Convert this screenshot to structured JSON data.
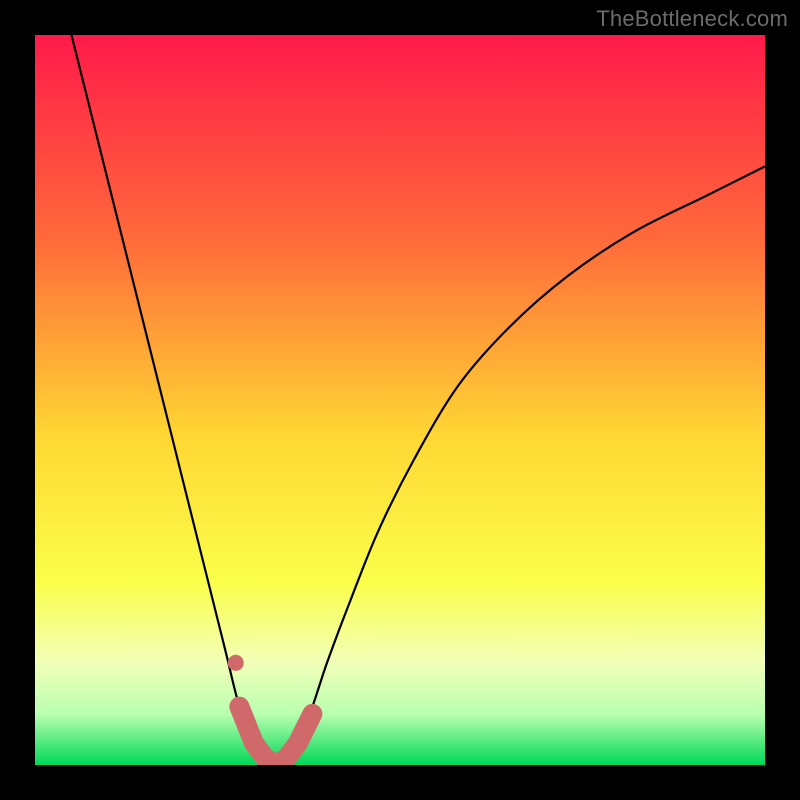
{
  "watermark": "TheBottleneck.com",
  "colors": {
    "frame": "#000000",
    "gradient_top": "#ff1a4a",
    "gradient_mid1": "#ff7a33",
    "gradient_mid2": "#ffef33",
    "gradient_low": "#f6ffb0",
    "gradient_bottom": "#00e05a",
    "curve": "#000000",
    "marker_fill": "#d57272",
    "marker_stroke": "#c55c5c"
  },
  "chart_data": {
    "type": "line",
    "title": "",
    "xlabel": "",
    "ylabel": "",
    "xlim": [
      0,
      100
    ],
    "ylim": [
      0,
      100
    ],
    "series": [
      {
        "name": "bottleneck-curve",
        "x": [
          5,
          8,
          11,
          14,
          17,
          20,
          23,
          26,
          28,
          30,
          31.5,
          33,
          34.5,
          36,
          38,
          40,
          43,
          47,
          52,
          58,
          65,
          73,
          82,
          92,
          100
        ],
        "y": [
          100,
          88,
          76,
          64,
          52,
          40,
          28,
          16,
          8,
          3,
          1,
          0,
          1,
          3,
          8,
          14,
          22,
          32,
          42,
          52,
          60,
          67,
          73,
          78,
          82
        ]
      }
    ],
    "markers": {
      "name": "highlight-segment",
      "x": [
        28,
        30,
        31.5,
        33,
        34.5,
        36,
        38
      ],
      "y": [
        8,
        3,
        1,
        0,
        1,
        3,
        7
      ]
    },
    "extra_marker": {
      "name": "outlier-dot",
      "x": 27.5,
      "y": 14
    }
  }
}
